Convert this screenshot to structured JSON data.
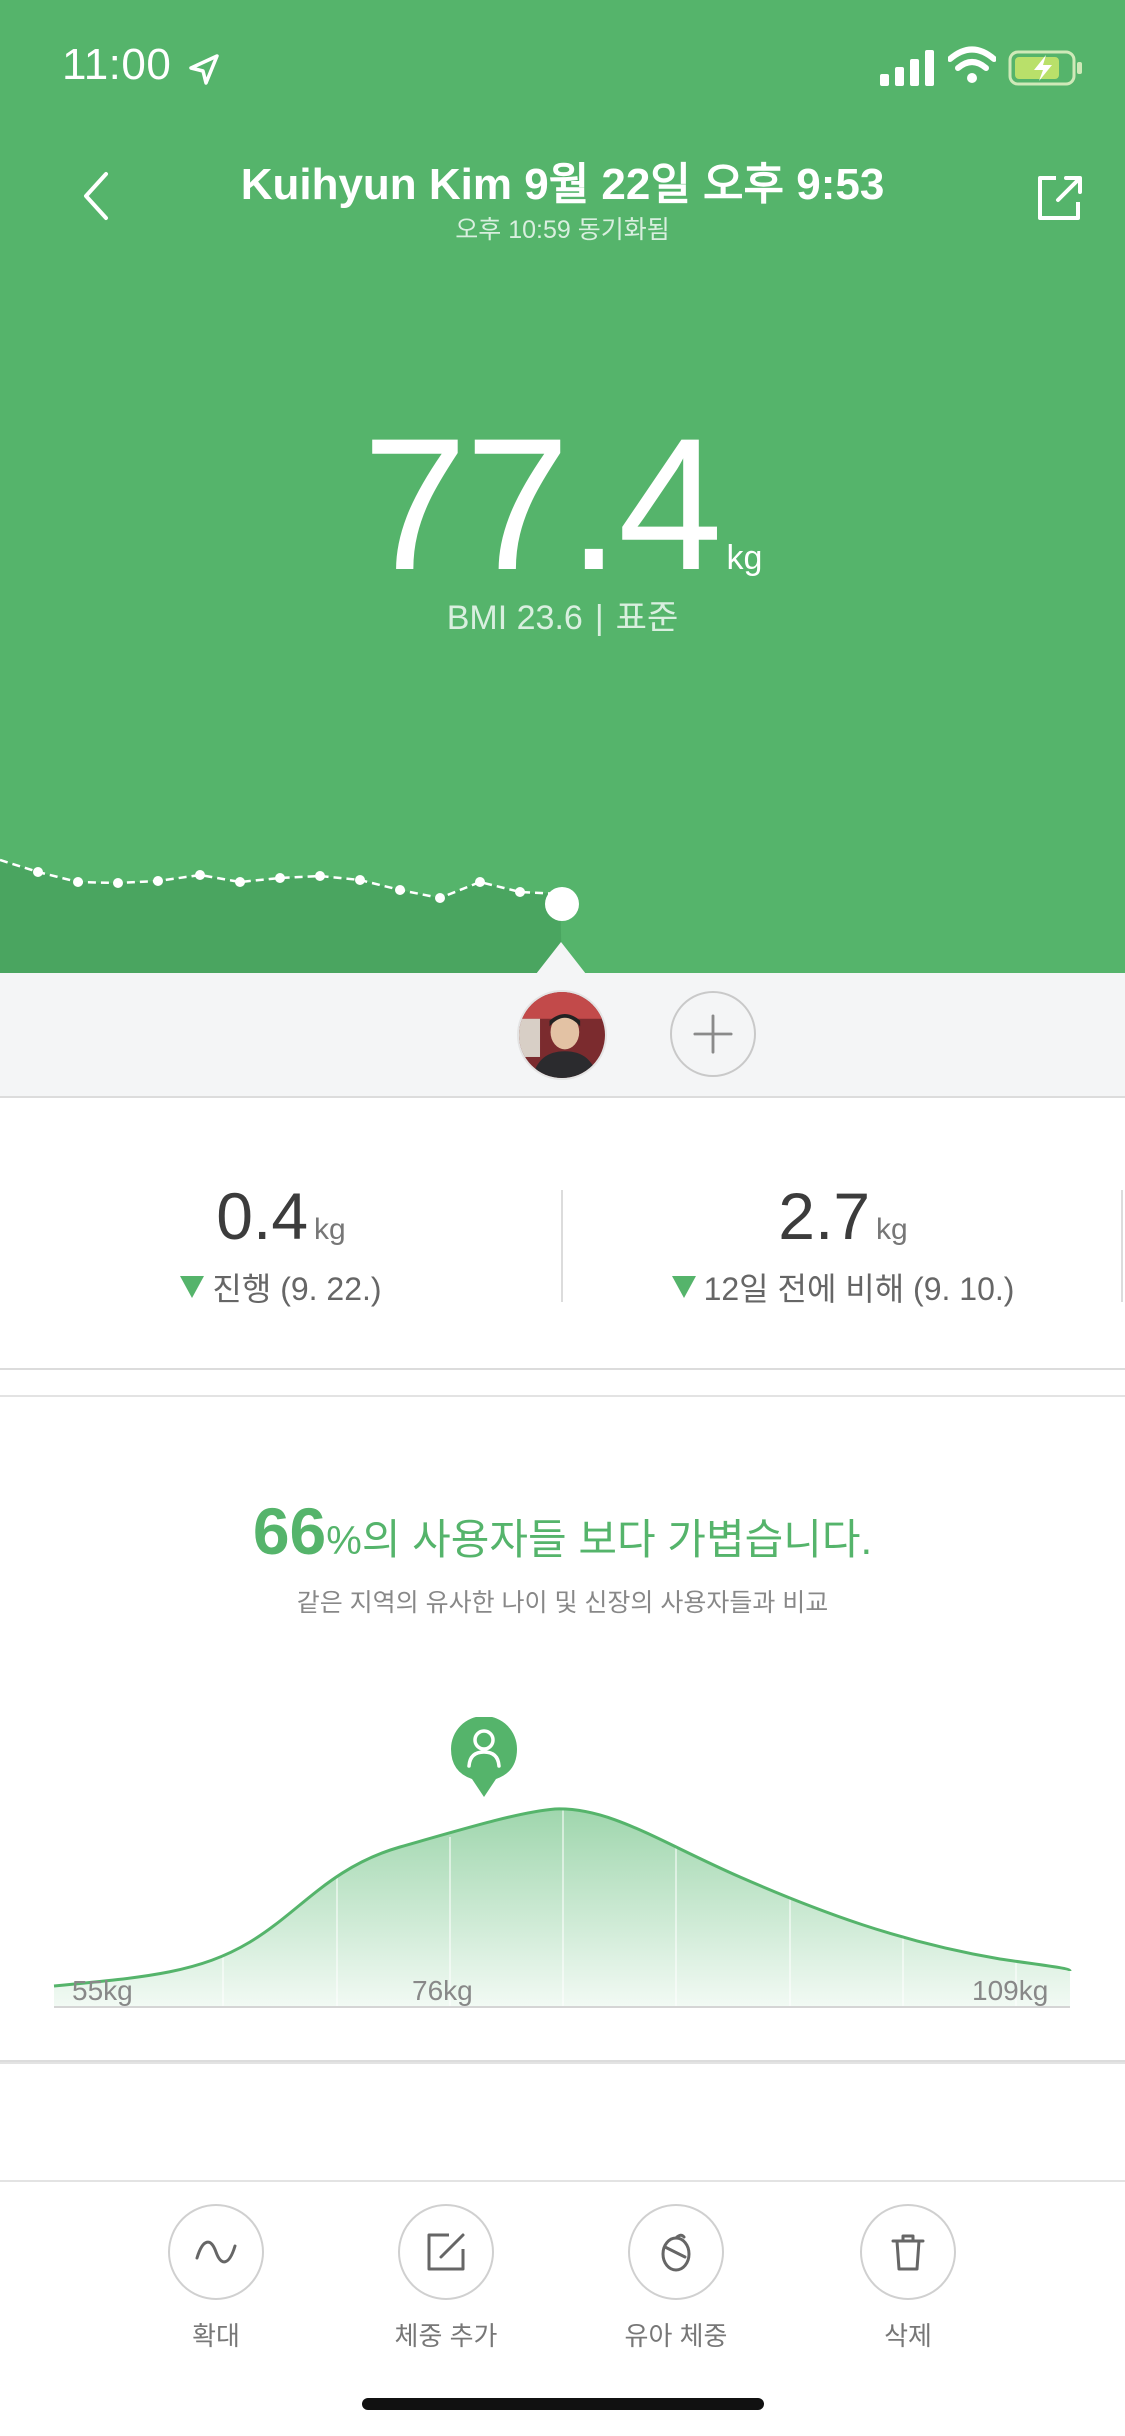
{
  "status_bar": {
    "time": "11:00",
    "icons": [
      "location-arrow-icon",
      "cellular-signal-icon",
      "wifi-icon",
      "battery-charging-icon"
    ]
  },
  "header": {
    "title": "Kuihyun Kim 9월 22일 오후 9:53",
    "subtitle": "오후 10:59 동기화됨",
    "back_icon": "chevron-left-icon",
    "share_icon": "share-icon"
  },
  "weight": {
    "value": "77.4",
    "unit": "kg",
    "bmi_label": "BMI 23.6",
    "bmi_separator": "|",
    "bmi_status": "표준"
  },
  "colors": {
    "brand_green": "#55b46b",
    "light_text": "#d9efdf",
    "divider": "#dcdcdc"
  },
  "stats": {
    "left": {
      "value": "0.4",
      "unit": "kg",
      "desc": "진행 (9. 22.)"
    },
    "right": {
      "value": "2.7",
      "unit": "kg",
      "desc": "12일 전에 비해 (9. 10.)"
    }
  },
  "comparison": {
    "percent": "66",
    "percent_sign": "%",
    "headline_rest": "의 사용자들 보다 가볍습니다.",
    "subtitle": "같은 지역의 유사한 나이 및 신장의 사용자들과 비교",
    "labels": {
      "min": "55kg",
      "mid": "76kg",
      "max": "109kg"
    },
    "user_marker_icon": "user-pin-icon"
  },
  "toolbar": {
    "items": [
      {
        "label": "확대",
        "icon": "wave-icon"
      },
      {
        "label": "체중 추가",
        "icon": "edit-icon"
      },
      {
        "label": "유아 체중",
        "icon": "baby-icon"
      },
      {
        "label": "삭제",
        "icon": "trash-icon"
      }
    ]
  }
}
